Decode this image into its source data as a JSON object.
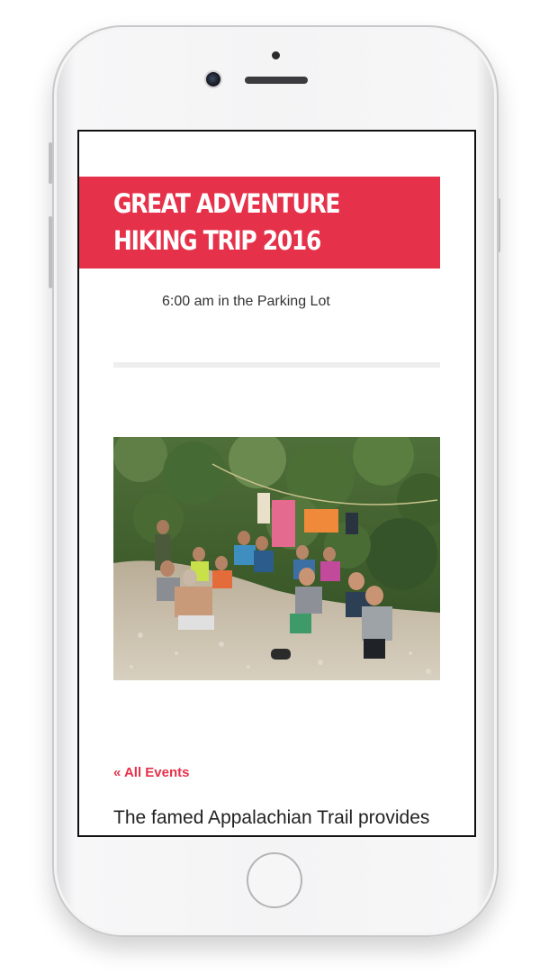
{
  "event": {
    "title": "GREAT ADVENTURE HIKING TRIP 2016",
    "time_location": "6:00 am in the Parking Lot",
    "back_link": "« All Events",
    "description": "The famed Appalachian Trail provides"
  },
  "colors": {
    "accent": "#e5314a",
    "text": "#333333",
    "divider": "#eeeeee"
  },
  "icons": {
    "camera": "front-camera-icon",
    "home": "home-button-icon"
  }
}
